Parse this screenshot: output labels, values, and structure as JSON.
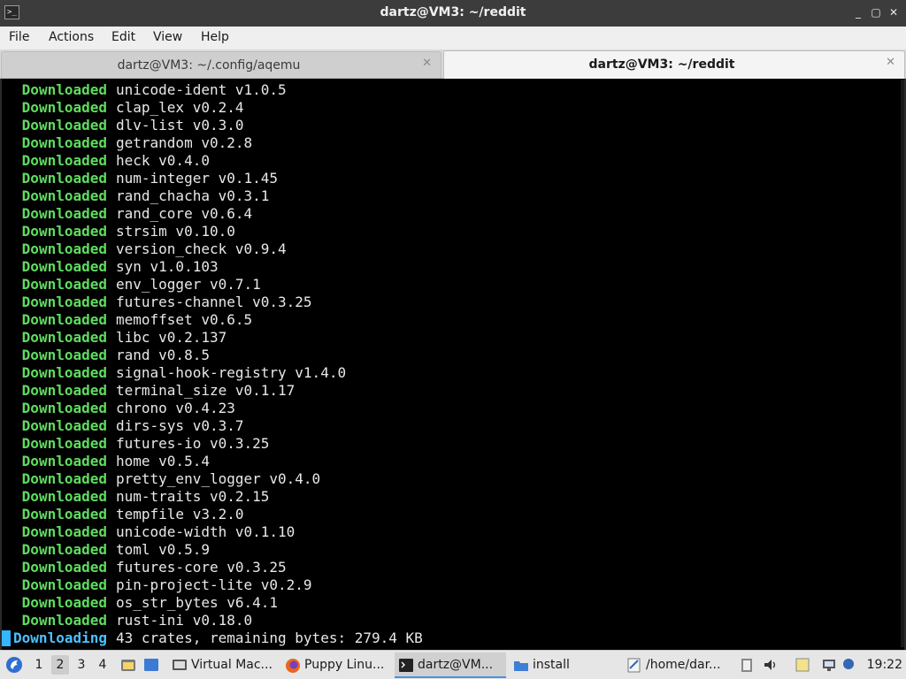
{
  "window": {
    "title": "dartz@VM3: ~/reddit",
    "app_icon": ">_",
    "minimize": "_",
    "restore": "▢",
    "close": "✕"
  },
  "menu": [
    "File",
    "Actions",
    "Edit",
    "View",
    "Help"
  ],
  "tabs": [
    {
      "label": "dartz@VM3: ~/.config/aqemu",
      "close": "✕",
      "active": false
    },
    {
      "label": "dartz@VM3: ~/reddit",
      "close": "✕",
      "active": true
    }
  ],
  "terminal": {
    "lines": [
      {
        "kw": "Downloaded",
        "text": "unicode-ident v1.0.5"
      },
      {
        "kw": "Downloaded",
        "text": "clap_lex v0.2.4"
      },
      {
        "kw": "Downloaded",
        "text": "dlv-list v0.3.0"
      },
      {
        "kw": "Downloaded",
        "text": "getrandom v0.2.8"
      },
      {
        "kw": "Downloaded",
        "text": "heck v0.4.0"
      },
      {
        "kw": "Downloaded",
        "text": "num-integer v0.1.45"
      },
      {
        "kw": "Downloaded",
        "text": "rand_chacha v0.3.1"
      },
      {
        "kw": "Downloaded",
        "text": "rand_core v0.6.4"
      },
      {
        "kw": "Downloaded",
        "text": "strsim v0.10.0"
      },
      {
        "kw": "Downloaded",
        "text": "version_check v0.9.4"
      },
      {
        "kw": "Downloaded",
        "text": "syn v1.0.103"
      },
      {
        "kw": "Downloaded",
        "text": "env_logger v0.7.1"
      },
      {
        "kw": "Downloaded",
        "text": "futures-channel v0.3.25"
      },
      {
        "kw": "Downloaded",
        "text": "memoffset v0.6.5"
      },
      {
        "kw": "Downloaded",
        "text": "libc v0.2.137"
      },
      {
        "kw": "Downloaded",
        "text": "rand v0.8.5"
      },
      {
        "kw": "Downloaded",
        "text": "signal-hook-registry v1.4.0"
      },
      {
        "kw": "Downloaded",
        "text": "terminal_size v0.1.17"
      },
      {
        "kw": "Downloaded",
        "text": "chrono v0.4.23"
      },
      {
        "kw": "Downloaded",
        "text": "dirs-sys v0.3.7"
      },
      {
        "kw": "Downloaded",
        "text": "futures-io v0.3.25"
      },
      {
        "kw": "Downloaded",
        "text": "home v0.5.4"
      },
      {
        "kw": "Downloaded",
        "text": "pretty_env_logger v0.4.0"
      },
      {
        "kw": "Downloaded",
        "text": "num-traits v0.2.15"
      },
      {
        "kw": "Downloaded",
        "text": "tempfile v3.2.0"
      },
      {
        "kw": "Downloaded",
        "text": "unicode-width v0.1.10"
      },
      {
        "kw": "Downloaded",
        "text": "toml v0.5.9"
      },
      {
        "kw": "Downloaded",
        "text": "futures-core v0.3.25"
      },
      {
        "kw": "Downloaded",
        "text": "pin-project-lite v0.2.9"
      },
      {
        "kw": "Downloaded",
        "text": "os_str_bytes v6.4.1"
      },
      {
        "kw": "Downloaded",
        "text": "rust-ini v0.18.0"
      },
      {
        "kw": "Downloading",
        "text": "43 crates, remaining bytes: 279.4 KB"
      }
    ],
    "colors": {
      "keyword": "#5fdc5f",
      "progress": "#4ec0ff",
      "text": "#e8e8e8",
      "background": "#000000"
    }
  },
  "taskbar": {
    "workspaces": [
      "1",
      "2",
      "3",
      "4"
    ],
    "active_workspace": "2",
    "tasks": [
      {
        "label": "Virtual Mac...",
        "icon": "virtualbox-icon"
      },
      {
        "label": "Puppy Linu...",
        "icon": "firefox-icon"
      },
      {
        "label": "dartz@VM...",
        "icon": "terminal-icon"
      },
      {
        "label": "install",
        "icon": "folder-icon"
      },
      {
        "label": "/home/dar...",
        "icon": "text-editor-icon"
      }
    ],
    "clock": "19:22"
  }
}
